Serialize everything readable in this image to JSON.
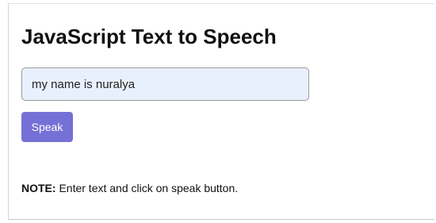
{
  "page": {
    "title": "JavaScript Text to Speech"
  },
  "input": {
    "value": "my name is nuralya"
  },
  "speak_button": {
    "label": "Speak"
  },
  "note": {
    "label": "NOTE:",
    "text": " Enter text and click on speak button."
  },
  "colors": {
    "button_background": "#7570d6",
    "input_background": "#e8f0fe",
    "title_text": "#111111"
  }
}
